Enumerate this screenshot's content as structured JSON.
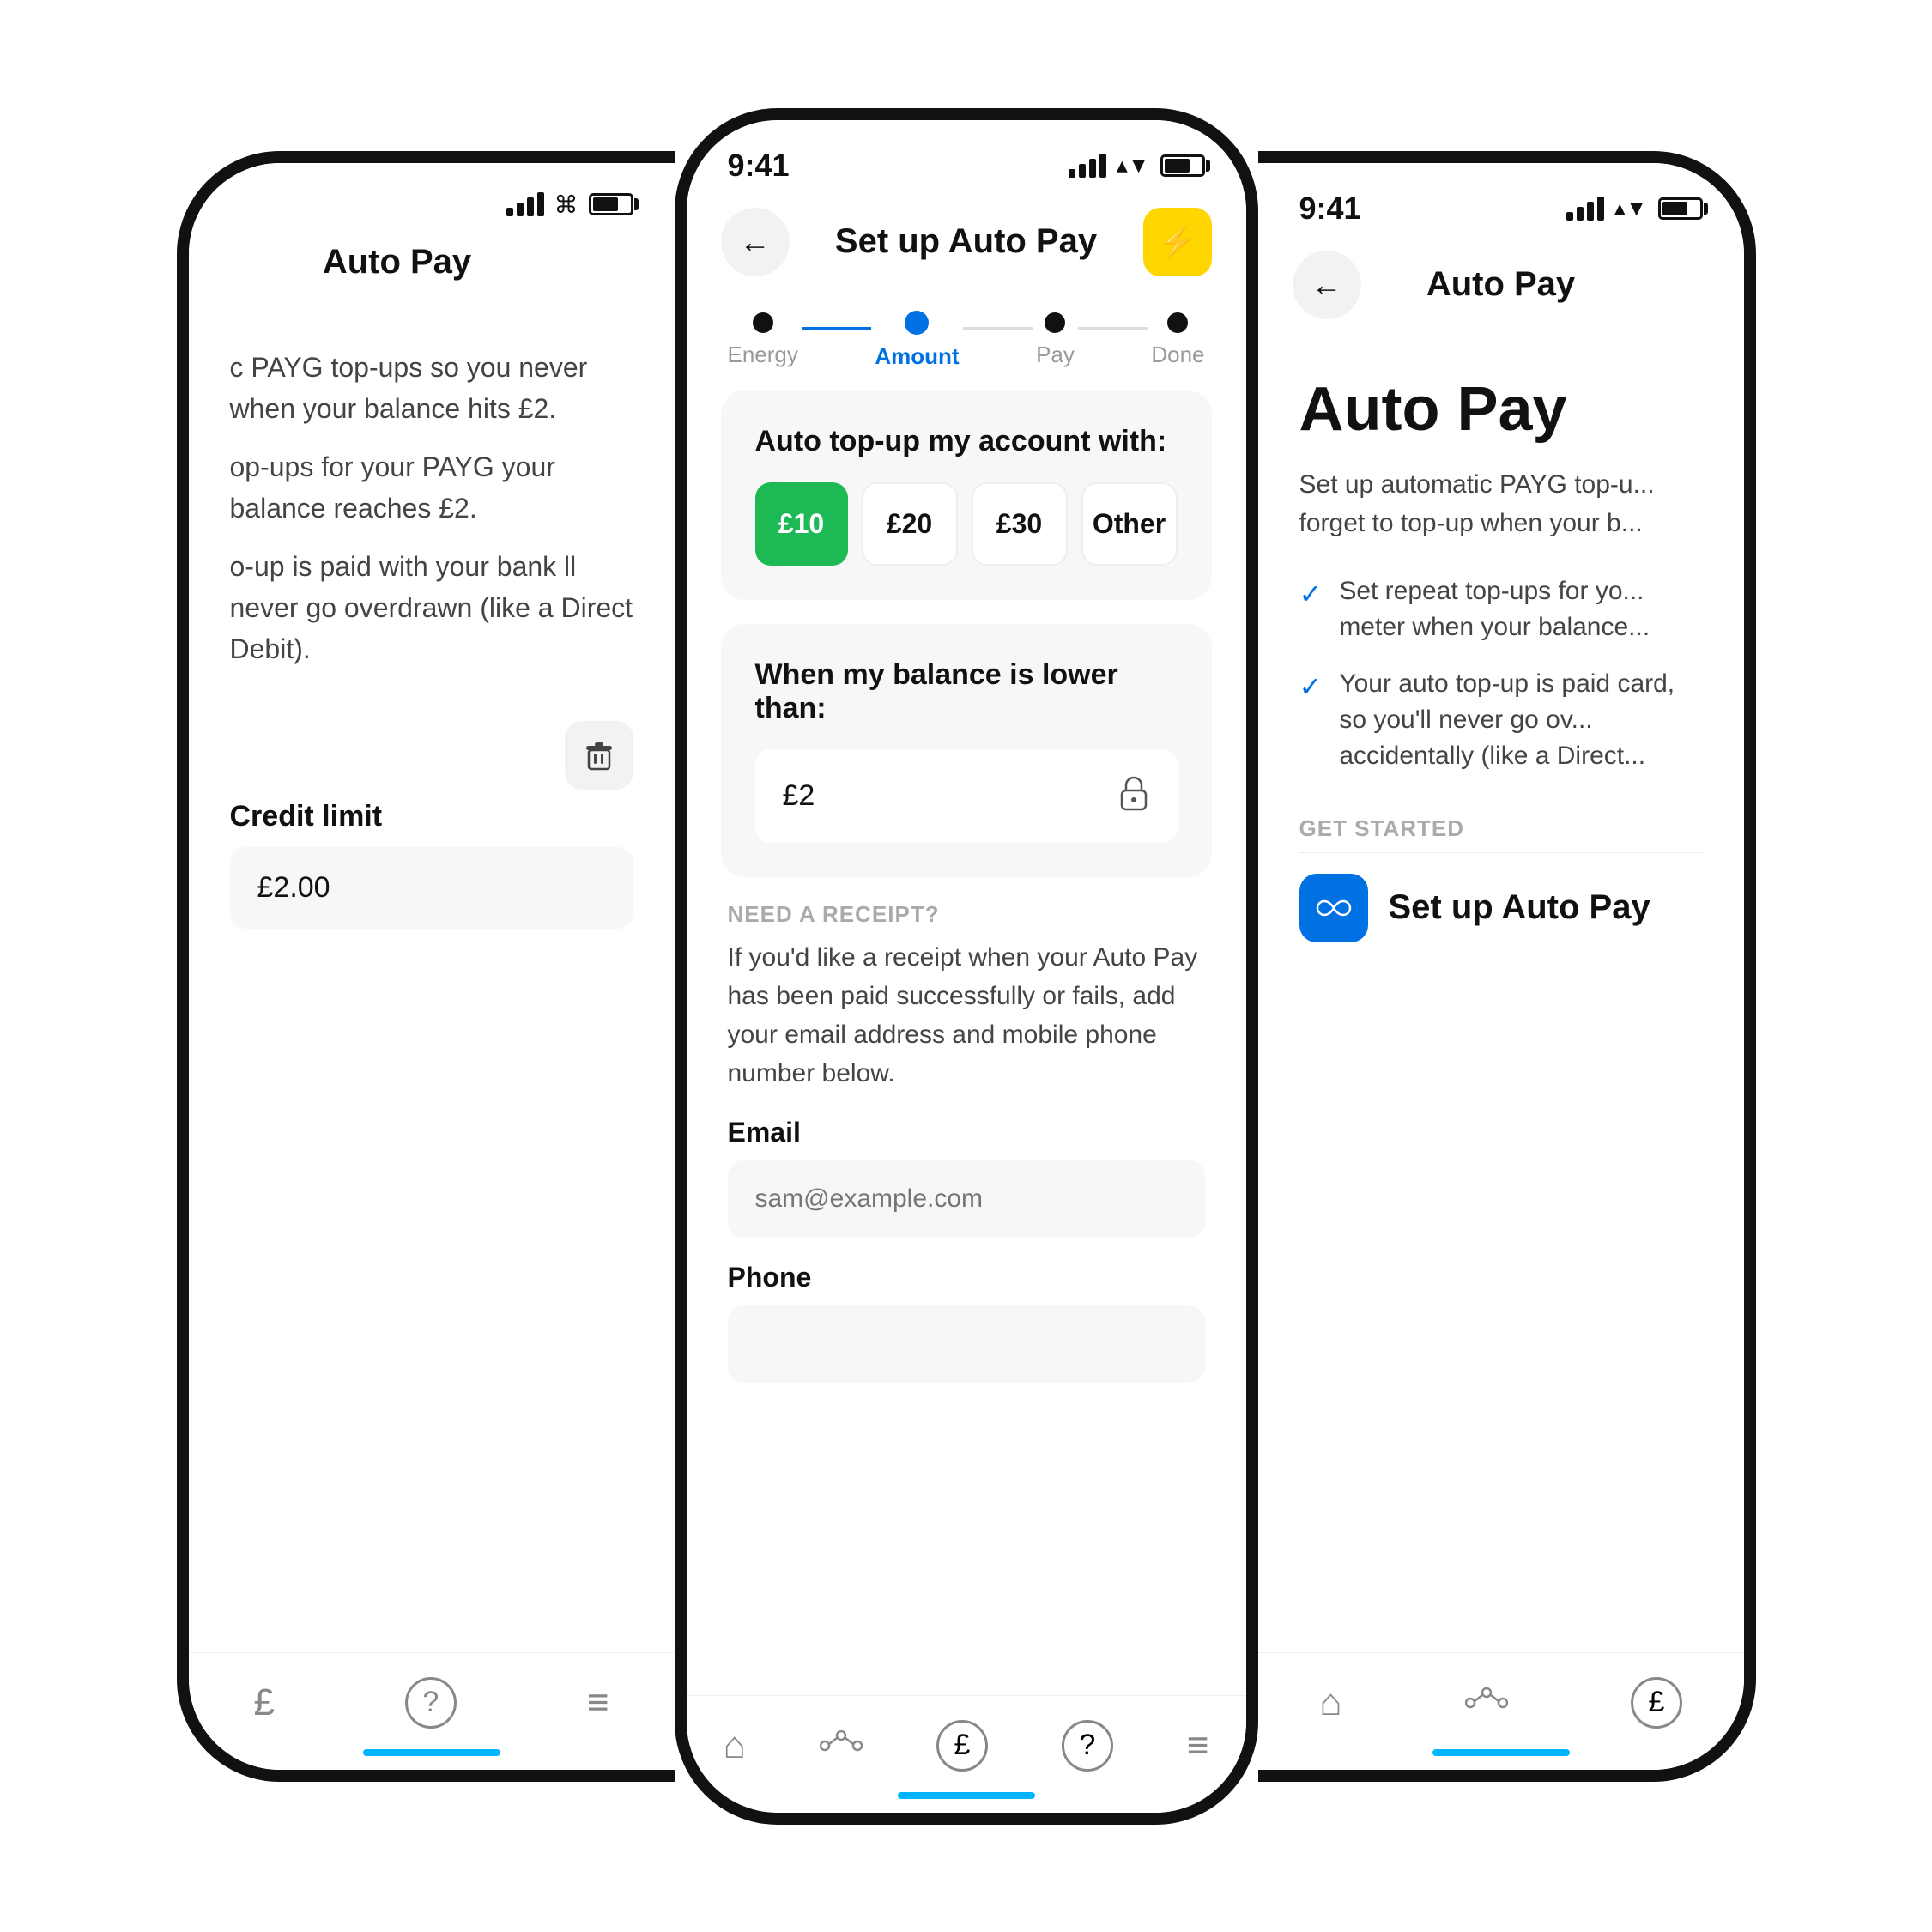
{
  "left_phone": {
    "title": "Auto Pay",
    "description1": "c PAYG top-ups so you never when your balance hits £2.",
    "description2": "op-ups for your PAYG your balance reaches £2.",
    "description3": "o-up is paid with your bank ll never go overdrawn (like a Direct Debit).",
    "credit_limit_label": "Credit limit",
    "credit_value": "£2.00",
    "nav": {
      "icons": [
        "£",
        "?",
        "≡"
      ]
    }
  },
  "center_phone": {
    "status_time": "9:41",
    "header": {
      "back_label": "←",
      "title": "Set up Auto Pay",
      "action_icon": "⚡"
    },
    "steps": [
      {
        "label": "Energy",
        "state": "done"
      },
      {
        "label": "Amount",
        "state": "active"
      },
      {
        "label": "Pay",
        "state": "pending"
      },
      {
        "label": "Done",
        "state": "pending"
      }
    ],
    "amount_card": {
      "title": "Auto top-up my account with:",
      "options": [
        {
          "label": "£10",
          "selected": true
        },
        {
          "label": "£20",
          "selected": false
        },
        {
          "label": "£30",
          "selected": false
        },
        {
          "label": "Other",
          "selected": false
        }
      ]
    },
    "balance_card": {
      "title": "When my balance is lower than:",
      "value": "£2"
    },
    "receipt": {
      "section_label": "NEED A RECEIPT?",
      "description": "If you'd like a receipt when your Auto Pay has been paid successfully or fails, add your email address and mobile phone number below.",
      "email_label": "Email",
      "email_placeholder": "sam@example.com",
      "phone_label": "Phone"
    },
    "nav": {
      "icons": [
        "⌂",
        "∿",
        "£",
        "?",
        "≡"
      ]
    }
  },
  "right_phone": {
    "status_time": "9:41",
    "header": {
      "back_label": "←",
      "title": "Auto Pay"
    },
    "main_title": "Auto Pay",
    "description": "Set up automatic PAYG top-u... forget to top-up when your b...",
    "bullet1": "Set repeat top-ups for yo... meter when your balance...",
    "bullet2": "Your auto top-up is paid card, so you'll never go ov... accidentally (like a Direct...",
    "get_started_label": "GET STARTED",
    "setup_btn_label": "Set up Auto Pay",
    "nav": {
      "icons": [
        "⌂",
        "∿",
        "£"
      ]
    }
  }
}
